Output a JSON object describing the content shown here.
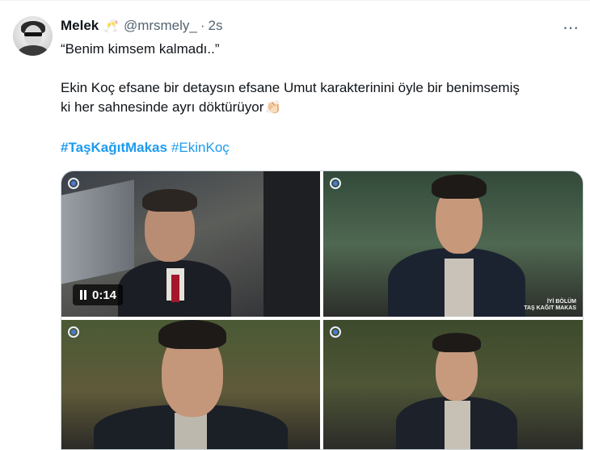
{
  "tweet": {
    "display_name": "Melek",
    "name_emoji": "🥂",
    "handle": "@mrsmely_",
    "separator": "·",
    "time": "2s",
    "more_icon": "⋯",
    "line1": "“Benim kimsem kalmadı..”",
    "line2": "Ekin Koç efsane bir detaysın efsane Umut karakterinini öyle bir benimsemiş",
    "line3": "ki her sahnesinde ayrı döktürüyor",
    "clap_emoji": "👏🏻",
    "hashtags": [
      "#TaşKağıtMakas",
      "#EkinKoç"
    ]
  },
  "media": {
    "video_duration": "0:14",
    "watermark_line1": "İYİ BÖLÜM",
    "watermark_line2": "TAŞ KAĞIT MAKAS"
  },
  "colors": {
    "link": "#1d9bf0",
    "secondary_text": "#536471",
    "border": "#cfd9de"
  }
}
